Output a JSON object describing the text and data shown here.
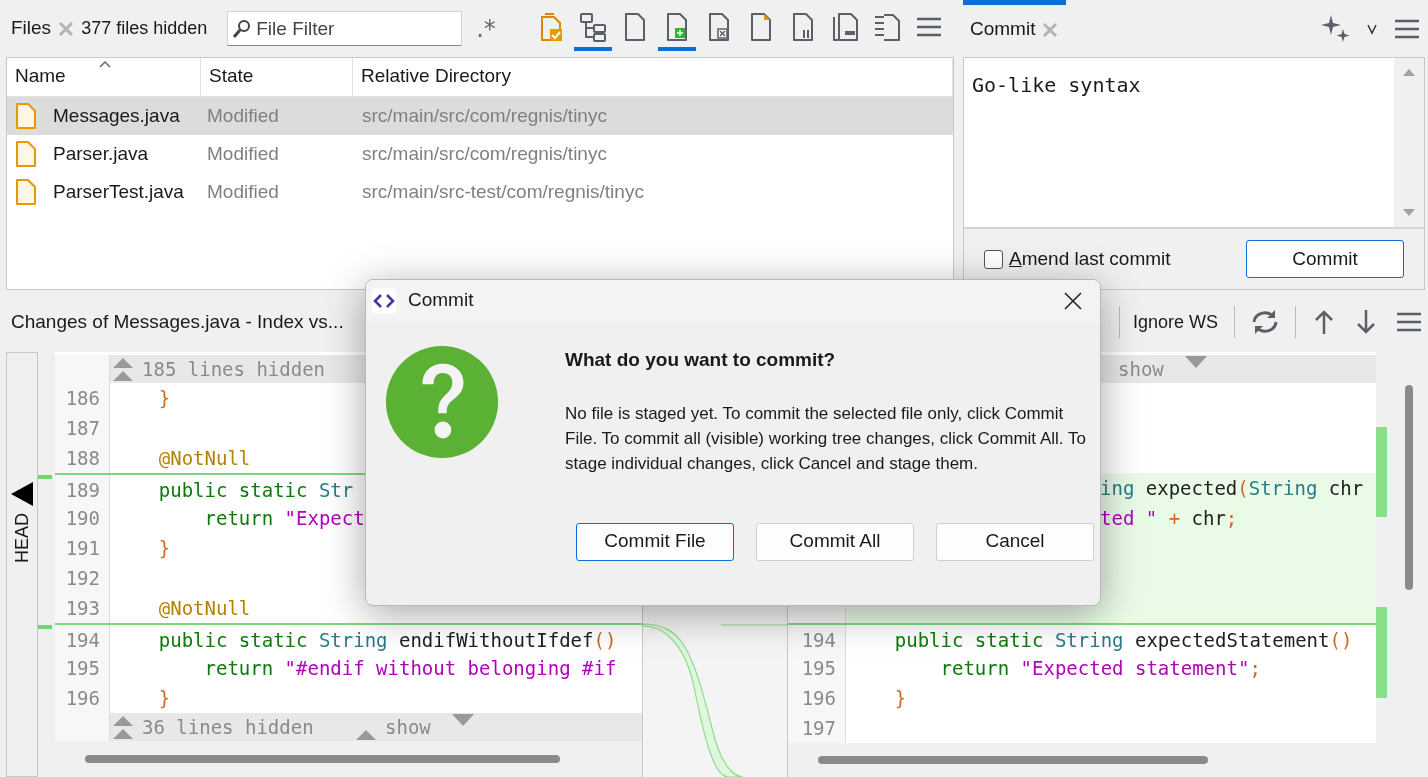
{
  "files_panel": {
    "title": "Files",
    "hidden_count": "377 files hidden",
    "filter": {
      "placeholder": "File Filter"
    },
    "regex_toggle": ".*",
    "toolbar": [
      {
        "kind": "file-check",
        "selected": false
      },
      {
        "kind": "tree",
        "selected": true
      },
      {
        "kind": "file",
        "selected": false
      },
      {
        "kind": "file-added",
        "selected": true
      },
      {
        "kind": "file-removed",
        "selected": false
      },
      {
        "kind": "file-modified",
        "selected": false
      },
      {
        "kind": "file-bars",
        "selected": false
      },
      {
        "kind": "files",
        "selected": false
      },
      {
        "kind": "list-file",
        "selected": false
      },
      {
        "kind": "menu",
        "selected": false
      }
    ],
    "table": {
      "columns": [
        {
          "label": "Name",
          "sorted": true
        },
        {
          "label": "State",
          "sorted": false
        },
        {
          "label": "Relative Directory",
          "sorted": false
        }
      ],
      "rows": [
        {
          "name": "Messages.java",
          "state": "Modified",
          "directory": "src/main/src/com/regnis/tinyc",
          "selected": true
        },
        {
          "name": "Parser.java",
          "state": "Modified",
          "directory": "src/main/src/com/regnis/tinyc",
          "selected": false
        },
        {
          "name": "ParserTest.java",
          "state": "Modified",
          "directory": "src/main/src-test/com/regnis/tinyc",
          "selected": false
        }
      ]
    }
  },
  "commit_panel": {
    "tab": "Commit",
    "message": "Go-like syntax",
    "amend": {
      "label": "Amend last commit",
      "checked": false
    },
    "commit_button": "Commit"
  },
  "diff": {
    "title": "Changes of Messages.java - Index vs...",
    "ignore_ws": "Ignore WS",
    "head_label": "HEAD",
    "left": {
      "top_bar": {
        "hidden": "185 lines hidden"
      },
      "lines": [
        {
          "number": "186",
          "tokens": [
            {
              "kind": "brace",
              "text": "    }"
            }
          ]
        },
        {
          "number": "187"
        },
        {
          "number": "188",
          "tokens": [
            {
              "kind": "annotation",
              "text": "    @NotNull"
            }
          ]
        },
        {
          "number": "189",
          "changed": true,
          "tokens": [
            {
              "kind": "keyword",
              "text": "    public static "
            },
            {
              "kind": "type",
              "text": "Str"
            }
          ]
        },
        {
          "number": "190",
          "tokens": [
            {
              "kind": "keyword",
              "text": "        return "
            },
            {
              "kind": "string",
              "text": "\"Expect"
            }
          ]
        },
        {
          "number": "191",
          "tokens": [
            {
              "kind": "brace",
              "text": "    }"
            }
          ]
        },
        {
          "number": "192"
        },
        {
          "number": "193",
          "tokens": [
            {
              "kind": "annotation",
              "text": "    @NotNull"
            }
          ]
        },
        {
          "number": "194",
          "changed": true,
          "tokens": [
            {
              "kind": "keyword",
              "text": "    public static "
            },
            {
              "kind": "type",
              "text": "String"
            },
            {
              "kind": "plain",
              "text": " endifWithoutIfdef"
            },
            {
              "kind": "brace",
              "text": "()"
            }
          ]
        },
        {
          "number": "195",
          "tokens": [
            {
              "kind": "keyword",
              "text": "        return "
            },
            {
              "kind": "string",
              "text": "\"#endif without belonging #if"
            }
          ]
        },
        {
          "number": "196",
          "tokens": [
            {
              "kind": "brace",
              "text": "    }"
            }
          ]
        }
      ],
      "bottom_bar": {
        "hidden": "36 lines hidden",
        "show": "show"
      }
    },
    "right": {
      "top_bar": {
        "show": "show"
      },
      "lines": [
        {
          "added": false
        },
        {
          "added": false
        },
        {
          "added": false
        },
        {
          "added": true,
          "clipped": true,
          "tokens": [
            {
              "kind": "type",
              "text": "ing"
            },
            {
              "kind": "plain",
              "text": " expected"
            },
            {
              "kind": "brace",
              "text": "("
            },
            {
              "kind": "type",
              "text": "String"
            },
            {
              "kind": "plain",
              "text": " chr"
            }
          ]
        },
        {
          "added": true,
          "clipped": true,
          "tokens": [
            {
              "kind": "string",
              "text": "ted \""
            },
            {
              "kind": "brace",
              "text": " + "
            },
            {
              "kind": "plain",
              "text": "chr"
            },
            {
              "kind": "brace",
              "text": ";"
            }
          ]
        },
        {
          "added": true
        },
        {
          "added": true
        },
        {
          "added": true
        },
        {
          "added": false,
          "changed": true,
          "number": "194",
          "tokens": [
            {
              "kind": "keyword",
              "text": "    public static "
            },
            {
              "kind": "type",
              "text": "String"
            },
            {
              "kind": "plain",
              "text": " expectedStatement"
            },
            {
              "kind": "brace",
              "text": "()"
            }
          ]
        },
        {
          "added": false,
          "number": "195",
          "tokens": [
            {
              "kind": "keyword",
              "text": "        return "
            },
            {
              "kind": "string",
              "text": "\"Expected statement\""
            },
            {
              "kind": "brace",
              "text": ";"
            }
          ]
        },
        {
          "added": false,
          "number": "196",
          "tokens": [
            {
              "kind": "brace",
              "text": "    }"
            }
          ]
        },
        {
          "added": false,
          "number": "197"
        }
      ]
    }
  },
  "dialog": {
    "title": "Commit",
    "heading": "What do you want to commit?",
    "message": "No file is staged yet. To commit the selected file only, click Commit File. To commit all (visible) working tree changes, click Commit All. To stage individual changes, click Cancel and stage them.",
    "buttons": [
      {
        "label": "Commit File",
        "default": true
      },
      {
        "label": "Commit All",
        "default": false
      },
      {
        "label": "Cancel",
        "default": false
      }
    ]
  }
}
